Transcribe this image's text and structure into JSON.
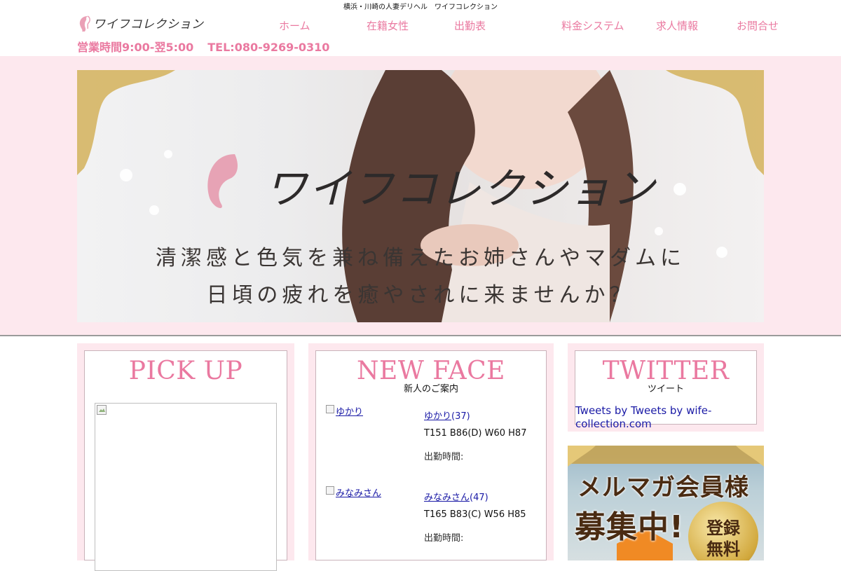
{
  "header": {
    "tagline": "横浜・川崎の人妻デリヘル　ワイフコレクション",
    "logo_text": "ワイフコレクション",
    "nav": [
      {
        "label": "ホーム"
      },
      {
        "label": "在籍女性"
      },
      {
        "label": "出勤表"
      },
      {
        "label": "料金システム"
      },
      {
        "label": "求人情報"
      },
      {
        "label": "お問合せ"
      }
    ],
    "hours": "営業時間9:00-翌5:00",
    "tel": "TEL:080-9269-0310"
  },
  "hero": {
    "brand": "ワイフコレクション",
    "line1": "清潔感と色気を兼ね備えたお姉さんやマダムに",
    "line2": "日頃の疲れを癒やされに来ませんか？"
  },
  "pickup": {
    "title": "PICK UP"
  },
  "newface": {
    "title": "NEW FACE",
    "subtitle": "新人のご案内",
    "items": [
      {
        "thumb_alt": "ゆかり",
        "name": "ゆかり",
        "age": "(37)",
        "size": "T151 B86(D) W60 H87",
        "time_label": "出勤時間:"
      },
      {
        "thumb_alt": "みなみさん",
        "name": "みなみさん",
        "age": "(47)",
        "size": "T165 B83(C) W56 H85",
        "time_label": "出勤時間:"
      }
    ]
  },
  "twitter": {
    "title": "TWITTER",
    "subtitle": "ツイート",
    "link_text": "Tweets by Tweets by wife-collection.com"
  },
  "mailmag": {
    "line1": "メルマガ会員様",
    "line2": "募集中!",
    "badge1": "登録",
    "badge2": "無料"
  },
  "colors": {
    "accent_pink": "#ea79a0",
    "panel_pink": "#fde8ee",
    "link_blue": "#1a1aa6"
  }
}
